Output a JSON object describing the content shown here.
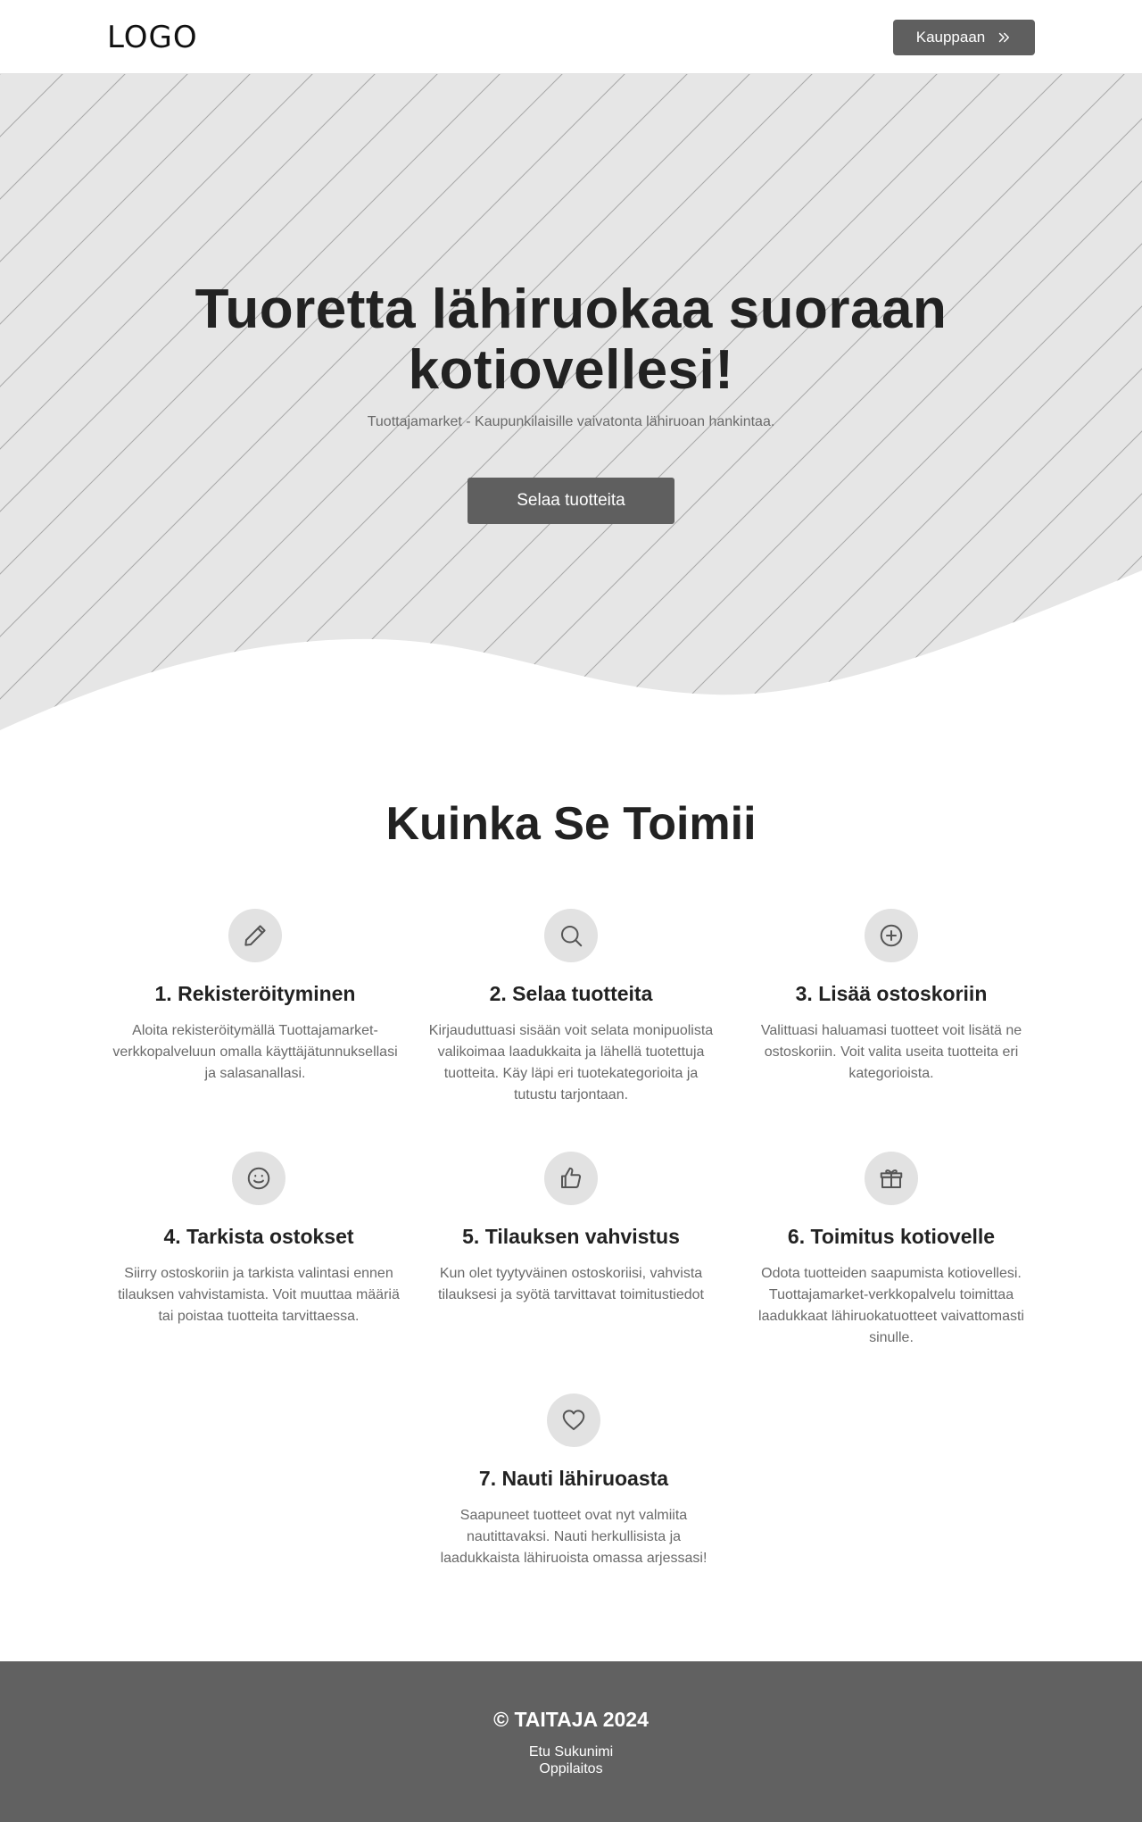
{
  "header": {
    "logo": "LOGO",
    "shop_button": "Kauppaan"
  },
  "hero": {
    "title": "Tuoretta lähiruokaa suoraan kotiovellesi!",
    "subtitle": "Tuottajamarket - Kaupunkilaisille vaivatonta lähiruoan hankintaa.",
    "cta": "Selaa tuotteita"
  },
  "how": {
    "title": "Kuinka Se Toimii",
    "steps": [
      {
        "icon": "pencil-icon",
        "title": "1. Rekisteröityminen",
        "text": "Aloita rekisteröitymällä Tuottajamarket-verkkopalveluun omalla käyttäjätunnuksellasi ja salasanallasi."
      },
      {
        "icon": "search-icon",
        "title": "2. Selaa tuotteita",
        "text": "Kirjauduttuasi sisään voit selata monipuolista valikoimaa laadukkaita ja lähellä tuotettuja tuotteita. Käy läpi eri tuotekategorioita ja tutustu tarjontaan."
      },
      {
        "icon": "plus-circle-icon",
        "title": "3. Lisää ostoskoriin",
        "text": "Valittuasi haluamasi tuotteet voit lisätä ne ostoskoriin. Voit valita useita tuotteita eri kategorioista."
      },
      {
        "icon": "smiley-icon",
        "title": "4. Tarkista ostokset",
        "text": "Siirry ostoskoriin ja tarkista valintasi ennen tilauksen vahvistamista. Voit muuttaa määriä tai poistaa tuotteita tarvittaessa."
      },
      {
        "icon": "thumbs-up-icon",
        "title": "5. Tilauksen vahvistus",
        "text": "Kun olet tyytyväinen ostoskoriisi, vahvista tilauksesi ja syötä tarvittavat toimitustiedot"
      },
      {
        "icon": "gift-icon",
        "title": "6. Toimitus kotiovelle",
        "text": "Odota tuotteiden saapumista kotiovellesi. Tuottajamarket-verkkopalvelu toimittaa laadukkaat lähiruokatuotteet vaivattomasti sinulle."
      },
      {
        "icon": "heart-icon",
        "title": "7. Nauti lähiruoasta",
        "text": "Saapuneet tuotteet ovat nyt valmiita nautittavaksi. Nauti herkullisista ja laadukkaista lähiruoista omassa arjessasi!"
      }
    ]
  },
  "footer": {
    "copyright": "© TAITAJA 2024",
    "name": "Etu Sukunimi",
    "school": "Oppilaitos"
  },
  "colors": {
    "button": "#5f5f5f",
    "hero_bg": "#e6e6e6",
    "footer_bg": "#616161",
    "icon_bg": "#e2e2e2"
  }
}
